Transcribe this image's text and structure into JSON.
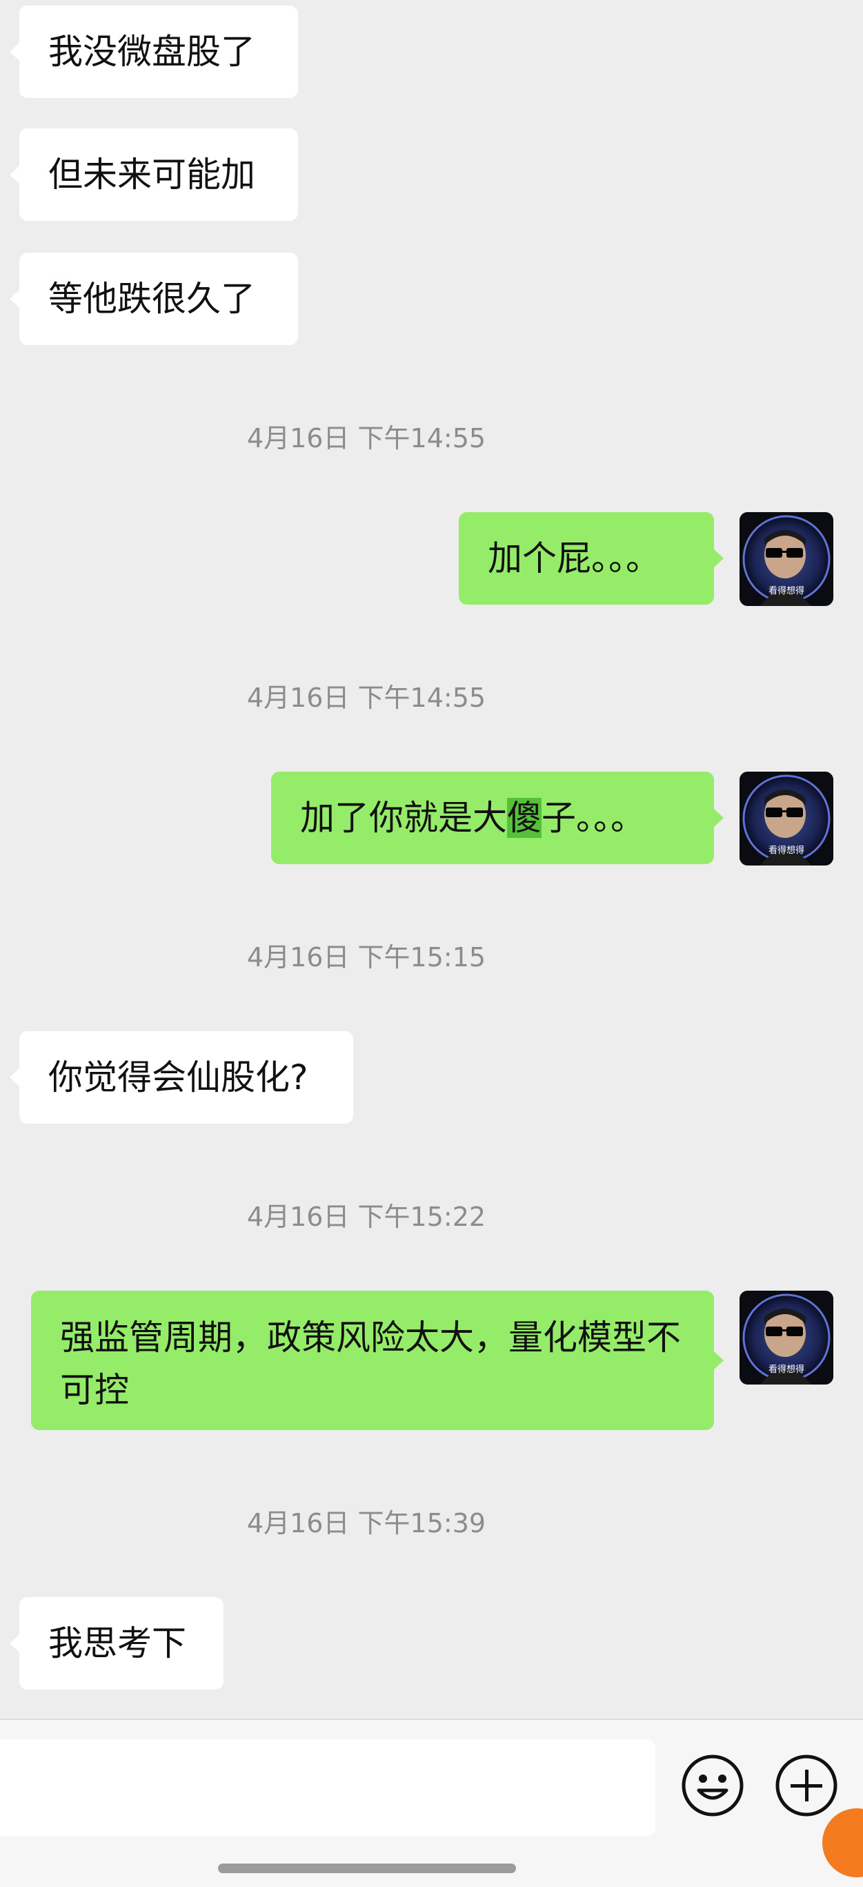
{
  "messages": [
    {
      "side": "in",
      "text": "我没微盘股了"
    },
    {
      "side": "in",
      "text": "但未来可能加"
    },
    {
      "side": "in",
      "text": "等他跌很久了"
    },
    {
      "timestamp": "4月16日 下午14:55"
    },
    {
      "side": "out",
      "text": "加个屁。。。"
    },
    {
      "timestamp": "4月16日 下午14:55"
    },
    {
      "side": "out",
      "text_before": "加了你就是大",
      "text_highlight": "傻",
      "text_after": "子。。。"
    },
    {
      "timestamp": "4月16日 下午15:15"
    },
    {
      "side": "in",
      "text": "你觉得会仙股化?"
    },
    {
      "timestamp": "4月16日 下午15:22"
    },
    {
      "side": "out",
      "text": "强监管周期，政策风险太大，量化模型不可控"
    },
    {
      "timestamp": "4月16日 下午15:39"
    },
    {
      "side": "in",
      "text": "我思考下"
    }
  ],
  "avatar": {
    "caption": "看得想得",
    "icon": "sunglasses-man-avatar"
  },
  "input_bar": {
    "placeholder": "",
    "value": "",
    "emoji_icon": "smiley-icon",
    "plus_icon": "plus-icon"
  },
  "colors": {
    "background": "#ededed",
    "incoming_bubble": "#ffffff",
    "outgoing_bubble": "#95ec69",
    "timestamp": "#8c8c8c"
  }
}
